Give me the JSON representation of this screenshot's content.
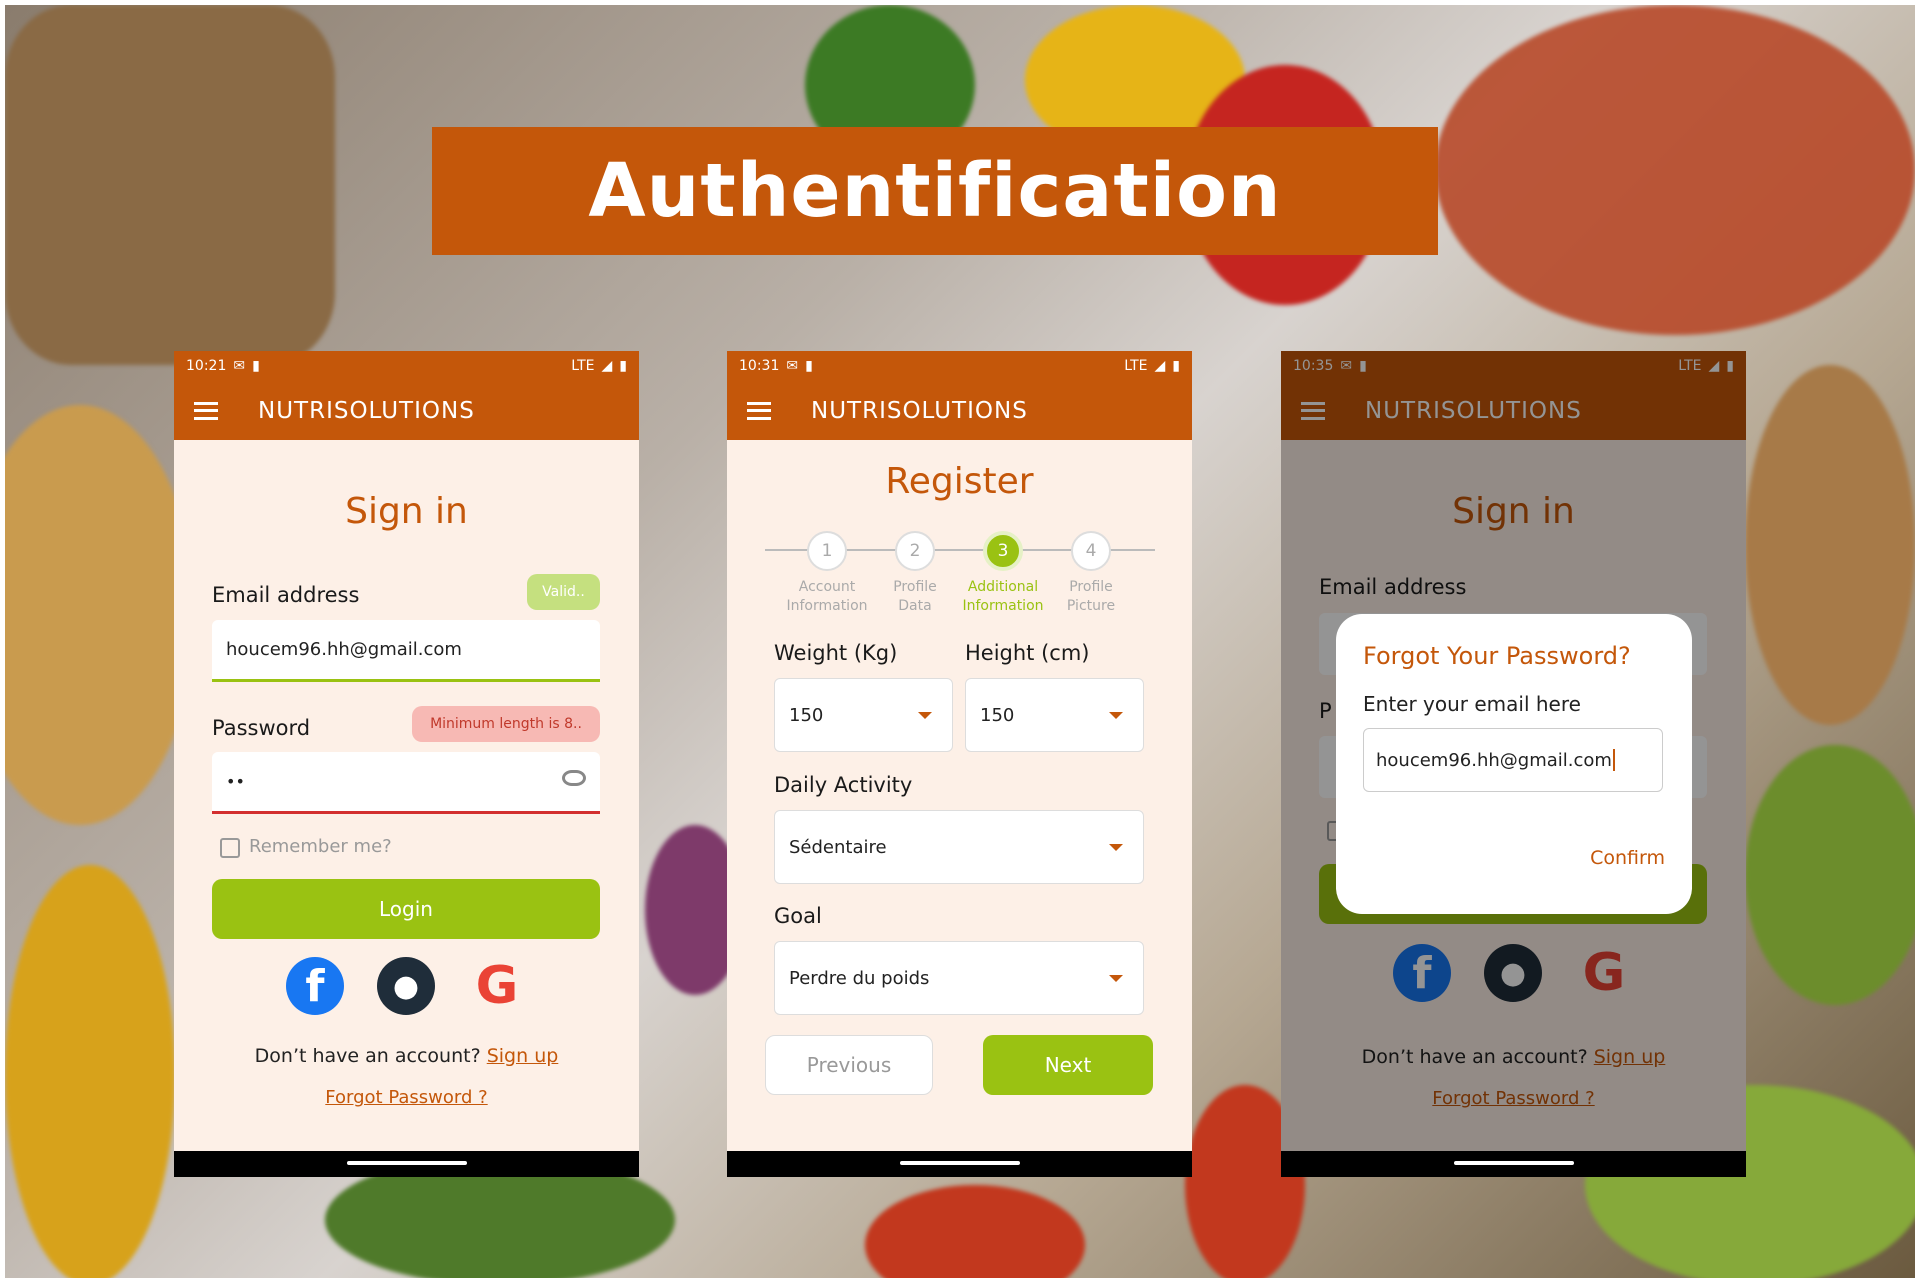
{
  "banner": {
    "title": "Authentification"
  },
  "colors": {
    "brand": "#c4570a",
    "accent_green": "#9ac212",
    "page_bg": "#fdf0e7",
    "error": "#d32f2f"
  },
  "signin_screen": {
    "status": {
      "time": "10:21",
      "network": "LTE"
    },
    "app_title": "NUTRISOLUTIONS",
    "heading": "Sign in",
    "email_label": "Email address",
    "email_chip": "Valid..",
    "email_value": "houcem96.hh@gmail.com",
    "password_label": "Password",
    "password_chip": "Minimum length is 8..",
    "password_value": "••",
    "remember_label": "Remember me?",
    "login_label": "Login",
    "social": [
      "facebook-icon",
      "apple-icon",
      "google-icon"
    ],
    "no_account_text": "Don’t have an account?",
    "signup_link": "Sign up",
    "forgot_link": "Forgot Password ?"
  },
  "register_screen": {
    "status": {
      "time": "10:31",
      "network": "LTE"
    },
    "app_title": "NUTRISOLUTIONS",
    "heading": "Register",
    "steps": [
      {
        "num": "1",
        "label1": "Account",
        "label2": "Information",
        "active": false
      },
      {
        "num": "2",
        "label1": "Profile",
        "label2": "Data",
        "active": false
      },
      {
        "num": "3",
        "label1": "Additional",
        "label2": "Information",
        "active": true
      },
      {
        "num": "4",
        "label1": "Profile",
        "label2": "Picture",
        "active": false
      }
    ],
    "weight_label": "Weight (Kg)",
    "weight_value": "150",
    "height_label": "Height (cm)",
    "height_value": "150",
    "activity_label": "Daily Activity",
    "activity_value": "Sédentaire",
    "goal_label": "Goal",
    "goal_value": "Perdre du poids",
    "previous_label": "Previous",
    "next_label": "Next"
  },
  "forgot_screen": {
    "status": {
      "time": "10:35",
      "network": "LTE"
    },
    "app_title": "NUTRISOLUTIONS",
    "heading": "Sign in",
    "email_label": "Email address",
    "password_label_partial": "P",
    "no_account_text": "Don’t have an account?",
    "signup_link": "Sign up",
    "forgot_link": "Forgot Password ?",
    "dialog": {
      "title": "Forgot Your Password?",
      "prompt": "Enter your email here",
      "email_value": "houcem96.hh@gmail.com",
      "confirm_label": "Confirm"
    }
  }
}
